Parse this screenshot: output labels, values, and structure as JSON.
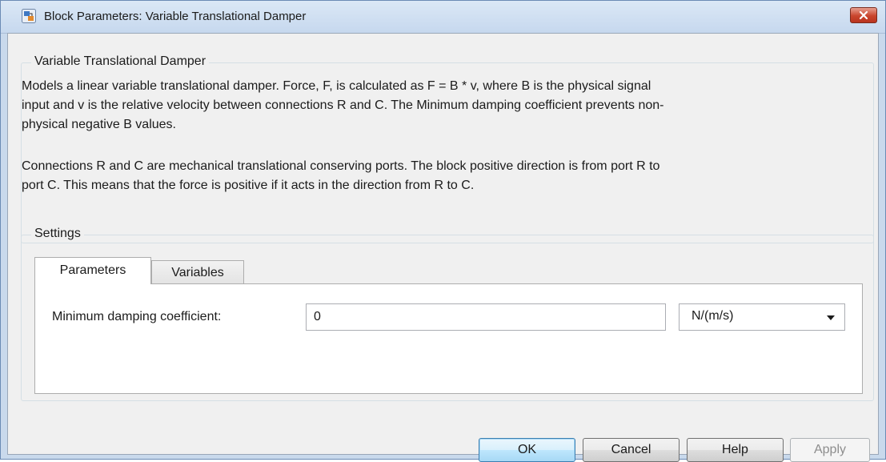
{
  "window": {
    "title": "Block Parameters: Variable Translational Damper",
    "icon": "simulink-block-icon",
    "close_icon": "close-icon"
  },
  "description_group": {
    "legend": "Variable Translational Damper",
    "paragraph1_lines": [
      "Models a linear variable translational damper. Force, F, is calculated as F = B * v, where B is the physical signal",
      "input and v is the relative velocity between connections R and C. The Minimum damping coefficient prevents non-",
      "physical negative B values."
    ],
    "paragraph2_lines": [
      "Connections R and C are mechanical translational conserving ports. The block positive direction is from port R to",
      "port C. This means that the force is positive if it acts in the direction from R to C."
    ]
  },
  "settings_group": {
    "legend": "Settings",
    "tabs": [
      {
        "label": "Parameters",
        "active": true
      },
      {
        "label": "Variables",
        "active": false
      }
    ],
    "parameters": [
      {
        "label": "Minimum damping coefficient:",
        "value": "0",
        "unit": "N/(m/s)"
      }
    ]
  },
  "buttons": {
    "ok": "OK",
    "cancel": "Cancel",
    "help": "Help",
    "apply": "Apply"
  },
  "colors": {
    "titlebar": "#c6d8ee",
    "client_bg": "#f0f0f0",
    "close_button": "#c9452d",
    "default_button": "#bee6fd"
  }
}
